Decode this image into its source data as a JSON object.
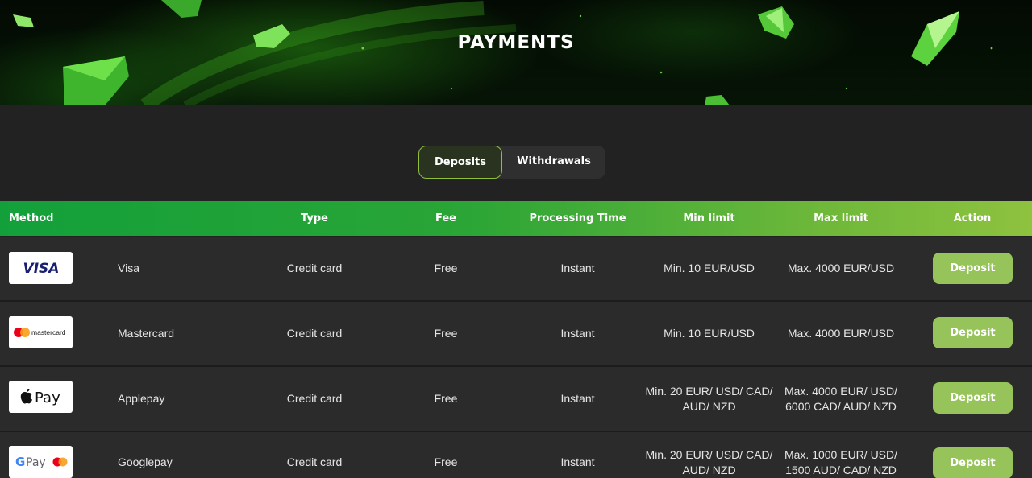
{
  "banner": {
    "title": "PAYMENTS"
  },
  "tabs": {
    "deposits": "Deposits",
    "withdrawals": "Withdrawals",
    "active": "Deposits"
  },
  "table": {
    "headers": {
      "method": "Method",
      "type": "Type",
      "fee": "Fee",
      "processing_time": "Processing Time",
      "min_limit": "Min limit",
      "max_limit": "Max limit",
      "action": "Action"
    },
    "rows": [
      {
        "logo": "visa-logo",
        "name": "Visa",
        "type": "Credit card",
        "fee": "Free",
        "time": "Instant",
        "min_line1": "Min. 10 EUR/USD",
        "min_line2": "",
        "max_line1": "Max. 4000 EUR/USD",
        "max_line2": "",
        "action": "Deposit"
      },
      {
        "logo": "mastercard-logo",
        "logo_text": "mastercard",
        "name": "Mastercard",
        "type": "Credit card",
        "fee": "Free",
        "time": "Instant",
        "min_line1": "Min. 10 EUR/USD",
        "min_line2": "",
        "max_line1": "Max. 4000 EUR/USD",
        "max_line2": "",
        "action": "Deposit"
      },
      {
        "logo": "applepay-logo",
        "logo_text": "Pay",
        "name": "Applepay",
        "type": "Credit card",
        "fee": "Free",
        "time": "Instant",
        "min_line1": "Min. 20 EUR/ USD/ CAD/",
        "min_line2": "AUD/ NZD",
        "max_line1": "Max. 4000 EUR/ USD/",
        "max_line2": "6000 CAD/ AUD/ NZD",
        "action": "Deposit"
      },
      {
        "logo": "googlepay-logo",
        "logo_text": "Pay",
        "name": "Googlepay",
        "type": "Credit card",
        "fee": "Free",
        "time": "Instant",
        "min_line1": "Min. 20 EUR/ USD/ CAD/",
        "min_line2": "AUD/ NZD",
        "max_line1": "Max. 1000 EUR/ USD/",
        "max_line2": "1500 AUD/ CAD/ NZD",
        "action": "Deposit"
      }
    ]
  },
  "colors": {
    "accent_green": "#96c45a",
    "header_gradient_start": "#13a03a",
    "header_gradient_end": "#8ec23f",
    "background": "#222222",
    "row_background": "#2b2b2b",
    "visa_blue": "#1a1f71",
    "mastercard_red": "#eb001b",
    "mastercard_orange": "#f79e1b"
  }
}
